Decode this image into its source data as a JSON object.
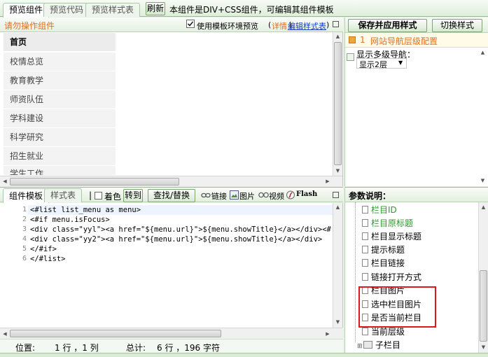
{
  "tabs": [
    {
      "label": "预览组件"
    },
    {
      "label": "预览代码"
    },
    {
      "label": "预览样式表"
    }
  ],
  "toolbar": {
    "refresh_label": "刷新",
    "notice": "本组件是DIV+CSS组件，可编辑其组件模板"
  },
  "preview": {
    "hint": "请勿操作组件",
    "env_checkbox_label": "使用模板环境预览",
    "env_checkbox_checked": true,
    "paren_open": "(",
    "detail_link": "详情",
    "separator": "|",
    "edit_style_link": "编辑样式表",
    "paren_close": ")",
    "nav_items": [
      "首页",
      "校情总览",
      "教育教学",
      "师资队伍",
      "学科建设",
      "科学研究",
      "招生就业",
      "学生工作"
    ]
  },
  "style_panel": {
    "save_apply_label": "保存并应用样式",
    "switch_style_label": "切换样式",
    "config_number": "1",
    "config_title": "网站导航层级配置",
    "multi_level_label": "显示多级导航：",
    "level_select_value": "显示2层"
  },
  "editor": {
    "tabs": [
      {
        "label": "组件模板"
      },
      {
        "label": "样式表"
      }
    ],
    "separator": "|",
    "color_label": "着色",
    "goto_label": "转到",
    "find_replace_label": "查找/替换",
    "link_label": "链接",
    "image_label": "图片",
    "video_label": "视频",
    "flash_label": "Flash",
    "lines": [
      {
        "num": "1",
        "text": "<#list list_menu as menu>"
      },
      {
        "num": "2",
        "text": "<#if menu.isFocus>"
      },
      {
        "num": "3",
        "text": "<div class=\"yyl\"><a href=\"${menu.url}\">${menu.showTitle}</a></div><#el"
      },
      {
        "num": "4",
        "text": "<div class=\"yy2\"><a href=\"${menu.url}\">${menu.showTitle}</a></div>"
      },
      {
        "num": "5",
        "text": "</#if>"
      },
      {
        "num": "6",
        "text": "</#list>"
      }
    ],
    "status": {
      "position_label": "位置:",
      "position_value": "1 行 ，1 列",
      "total_label": "总计:",
      "total_value": "6 行 ，196 字符"
    }
  },
  "params": {
    "title": "参数说明：",
    "items": [
      {
        "label": "栏目ID",
        "green": true
      },
      {
        "label": "栏目原标题",
        "green": true
      },
      {
        "label": "栏目显示标题",
        "green": false
      },
      {
        "label": "提示标题",
        "green": false
      },
      {
        "label": "栏目链接",
        "green": false
      },
      {
        "label": "链接打开方式",
        "green": false
      },
      {
        "label": "栏目图片",
        "green": false
      },
      {
        "label": "选中栏目图片",
        "green": false
      },
      {
        "label": "是否当前栏目",
        "green": false
      },
      {
        "label": "当前层级",
        "green": false
      },
      {
        "label": "子栏目",
        "green": false
      }
    ]
  },
  "colors": {
    "accent_green": "#2c9a2c",
    "hint_orange": "#e2711d",
    "link_blue": "#1a3fb8",
    "highlight_red": "#e0161e"
  }
}
